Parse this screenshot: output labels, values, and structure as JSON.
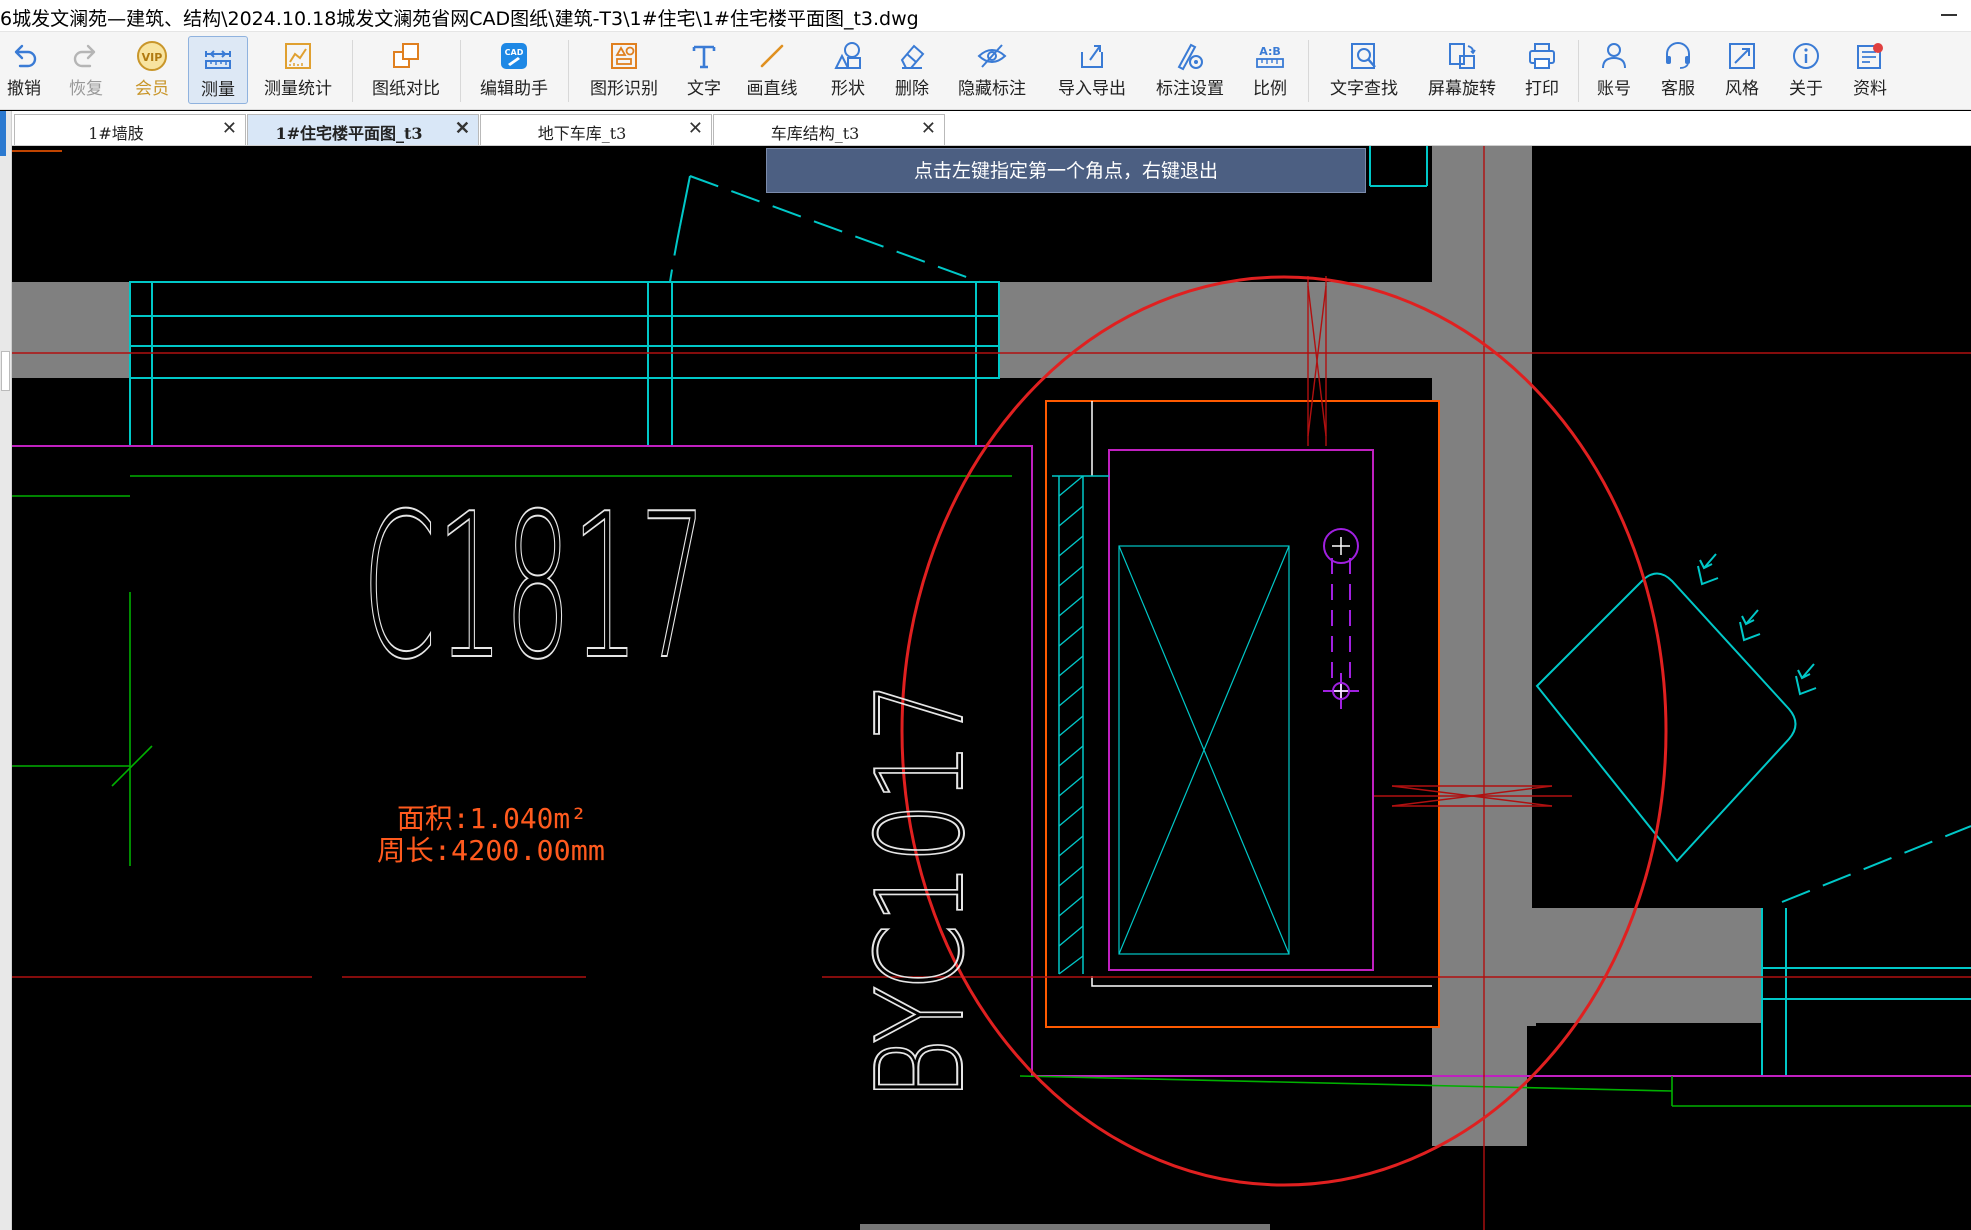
{
  "window": {
    "title": "6城发文澜苑—建筑、结构\\2024.10.18城发文澜苑省网CAD图纸\\建筑-T3\\1#住宅\\1#住宅楼平面图_t3.dwg"
  },
  "toolbar": {
    "items": [
      {
        "label": "撤销",
        "icon": "undo-icon"
      },
      {
        "label": "恢复",
        "icon": "redo-icon"
      },
      {
        "label": "会员",
        "icon": "vip-icon",
        "icon_text": "VIP"
      },
      {
        "label": "测量",
        "icon": "measure-icon"
      },
      {
        "label": "测量统计",
        "icon": "measure-stats-icon"
      },
      {
        "label": "图纸对比",
        "icon": "compare-icon"
      },
      {
        "label": "编辑助手",
        "icon": "edit-assistant-icon",
        "icon_text": "CAD"
      },
      {
        "label": "图形识别",
        "icon": "shape-recognize-icon"
      },
      {
        "label": "文字",
        "icon": "text-icon"
      },
      {
        "label": "画直线",
        "icon": "line-icon"
      },
      {
        "label": "形状",
        "icon": "shape-icon"
      },
      {
        "label": "删除",
        "icon": "eraser-icon"
      },
      {
        "label": "隐藏标注",
        "icon": "hide-annotation-icon"
      },
      {
        "label": "导入导出",
        "icon": "import-export-icon"
      },
      {
        "label": "标注设置",
        "icon": "annotation-settings-icon"
      },
      {
        "label": "比例",
        "icon": "scale-icon",
        "icon_text": "A:B"
      },
      {
        "label": "文字查找",
        "icon": "text-search-icon"
      },
      {
        "label": "屏幕旋转",
        "icon": "rotate-screen-icon"
      },
      {
        "label": "打印",
        "icon": "print-icon"
      },
      {
        "label": "账号",
        "icon": "account-icon"
      },
      {
        "label": "客服",
        "icon": "headset-icon"
      },
      {
        "label": "风格",
        "icon": "style-icon"
      },
      {
        "label": "关于",
        "icon": "info-icon"
      },
      {
        "label": "资料",
        "icon": "documents-icon"
      }
    ]
  },
  "tabs": [
    {
      "label": "1#墙肢",
      "active": false
    },
    {
      "label": "1#住宅楼平面图_t3",
      "active": true
    },
    {
      "label": "地下车库_t3",
      "active": false
    },
    {
      "label": "车库结构_t3",
      "active": false
    }
  ],
  "tab_close_glyph": "✕",
  "hint": "点击左键指定第一个角点，右键退出",
  "drawing": {
    "window_tag_1": "C1817",
    "window_tag_2": "BYC1017",
    "area_text": "面积:1.040m²",
    "perimeter_text": "周长:4200.00mm"
  },
  "colors": {
    "accent": "#2b79d0",
    "hint_bg": "#4c5f82",
    "cad_cyan": "#00c8c8",
    "cad_red": "#e02020",
    "cad_magenta": "#c020c0",
    "cad_orange": "#ff5a00",
    "wall_gray": "#808080",
    "measure_text": "#ff5a1e"
  }
}
